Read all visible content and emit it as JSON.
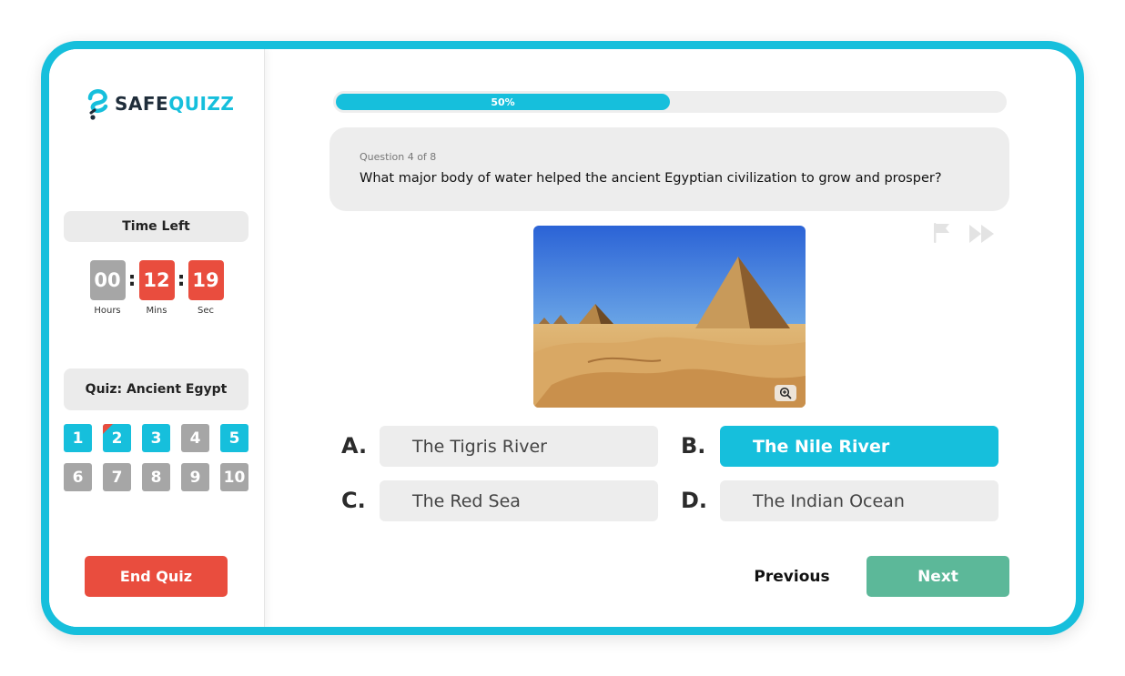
{
  "brand": {
    "safe": "SAFE",
    "quizz": "QUIZZ"
  },
  "timer": {
    "label": "Time Left",
    "hours": "00",
    "hours_caption": "Hours",
    "mins": "12",
    "mins_caption": "Mins",
    "secs": "19",
    "secs_caption": "Sec",
    "separator": ":"
  },
  "quiz": {
    "title": "Quiz: Ancient Egypt",
    "questions": [
      {
        "num": "1",
        "state": "answered"
      },
      {
        "num": "2",
        "state": "flagged"
      },
      {
        "num": "3",
        "state": "answered"
      },
      {
        "num": "4",
        "state": "unanswered"
      },
      {
        "num": "5",
        "state": "answered"
      },
      {
        "num": "6",
        "state": "unanswered"
      },
      {
        "num": "7",
        "state": "unanswered"
      },
      {
        "num": "8",
        "state": "unanswered"
      },
      {
        "num": "9",
        "state": "unanswered"
      },
      {
        "num": "10",
        "state": "unanswered"
      }
    ],
    "end_label": "End Quiz"
  },
  "progress": {
    "percent": 50,
    "label": "50%"
  },
  "question": {
    "counter": "Question 4 of 8",
    "text": "What major body of water helped the ancient Egyptian civilization to grow and prosper?"
  },
  "answers": [
    {
      "letter": "A.",
      "text": "The Tigris River",
      "selected": false
    },
    {
      "letter": "B.",
      "text": "The Nile River",
      "selected": true
    },
    {
      "letter": "C.",
      "text": "The Red Sea",
      "selected": false
    },
    {
      "letter": "D.",
      "text": "The Indian Ocean",
      "selected": false
    }
  ],
  "nav": {
    "previous": "Previous",
    "next": "Next"
  },
  "icons": {
    "flag": "flag-icon",
    "skip": "fast-forward-icon",
    "zoom": "zoom-in-icon",
    "logo": "question-mark-logo-icon"
  },
  "colors": {
    "accent": "#16bfdc",
    "danger": "#e94d3e",
    "success": "#5cb899",
    "inactive": "#a6a6a6"
  }
}
